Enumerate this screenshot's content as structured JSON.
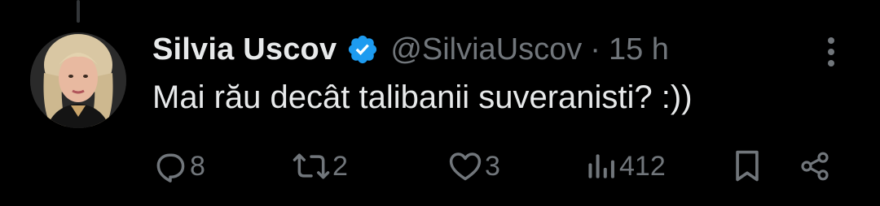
{
  "tweet": {
    "author_name": "Silvia Uscov",
    "handle": "@SilviaUscov",
    "separator": "·",
    "time": "15 h",
    "text": "Mai rău decât talibanii suveranisti? :))",
    "verified": true
  },
  "actions": {
    "replies": "8",
    "retweets": "2",
    "likes": "3",
    "views": "412"
  },
  "colors": {
    "background": "#000000",
    "primary_text": "#e7e9ea",
    "secondary_text": "#71767b",
    "verified_badge": "#1d9bf0"
  },
  "icons": [
    "reply-icon",
    "retweet-icon",
    "like-icon",
    "views-icon",
    "bookmark-icon",
    "share-icon",
    "more-icon",
    "verified-icon"
  ]
}
